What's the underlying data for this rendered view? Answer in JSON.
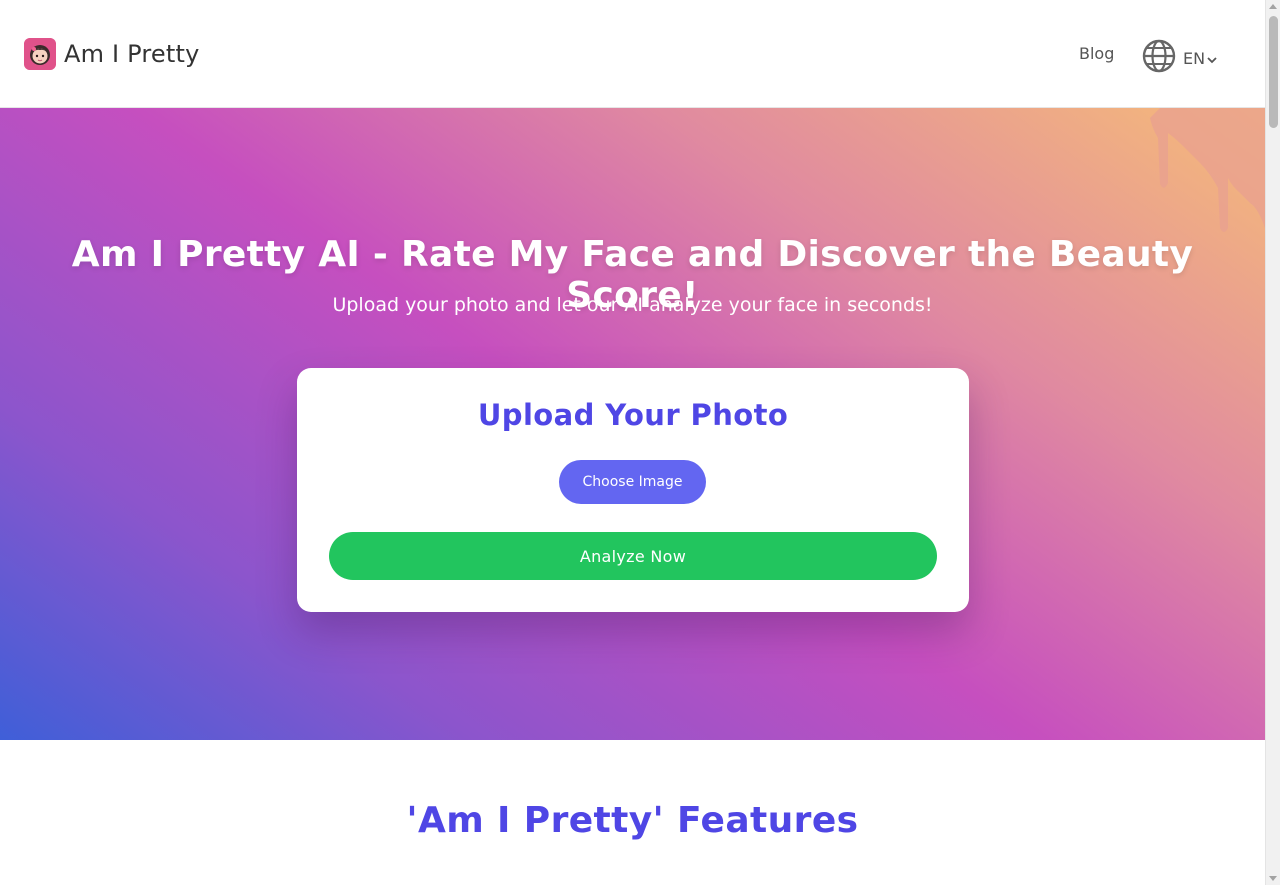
{
  "header": {
    "brand_name": "Am I Pretty",
    "nav_blog": "Blog",
    "language_code": "EN"
  },
  "hero": {
    "title": "Am I Pretty AI - Rate My Face and Discover the Beauty Score!",
    "subtitle": "Upload your photo and let our AI analyze your face in seconds!"
  },
  "upload_card": {
    "title": "Upload Your Photo",
    "choose_label": "Choose Image",
    "analyze_label": "Analyze Now"
  },
  "features": {
    "title": "'Am I Pretty' Features"
  },
  "colors": {
    "accent": "#4f46e5",
    "choose_button": "#6366f1",
    "analyze_button": "#22c55e",
    "logo_bg": "#e0528a"
  },
  "icons": {
    "logo": "avatar-girl-icon",
    "language": "globe-icon",
    "language_dropdown": "chevron-down-icon"
  }
}
